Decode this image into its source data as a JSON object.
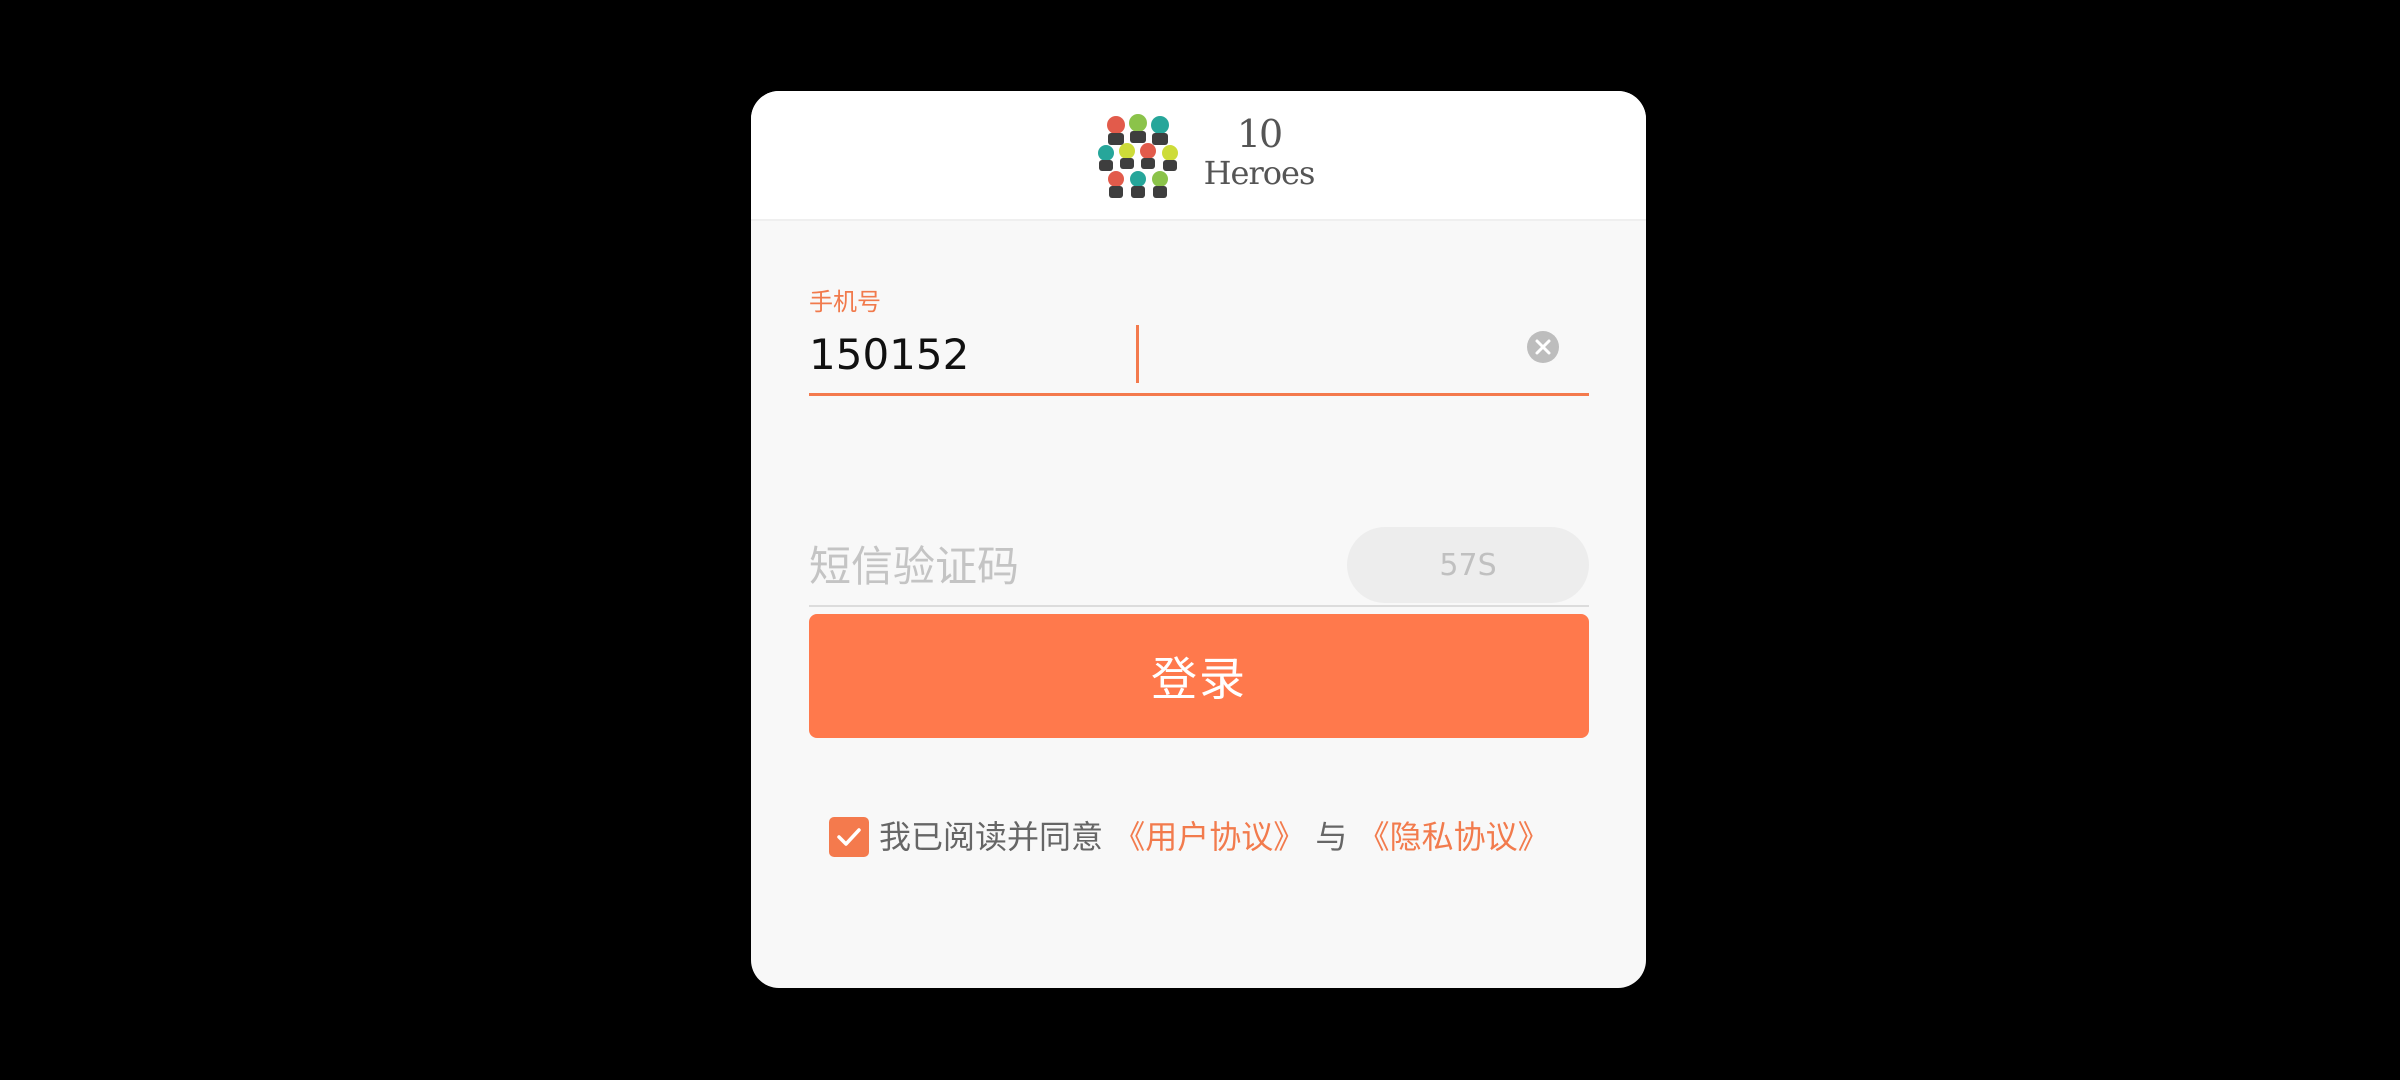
{
  "brand": {
    "logo_number": "10",
    "logo_word": "Heroes"
  },
  "form": {
    "phone_label": "手机号",
    "phone_value": "150152",
    "code_placeholder": "短信验证码",
    "sms_countdown": "57S",
    "login_label": "登录"
  },
  "agreement": {
    "checked": true,
    "text_before": "我已阅读并同意",
    "user_agreement": "《用户协议》",
    "and": "与",
    "privacy_agreement": "《隐私协议》"
  },
  "colors": {
    "accent": "#ff794c",
    "backdrop": "#000000",
    "card": "#f8f8f8"
  },
  "icons": {
    "clear": "clear-circle-icon",
    "check": "checkmark-icon",
    "logo": "heroes-logo-icon"
  }
}
